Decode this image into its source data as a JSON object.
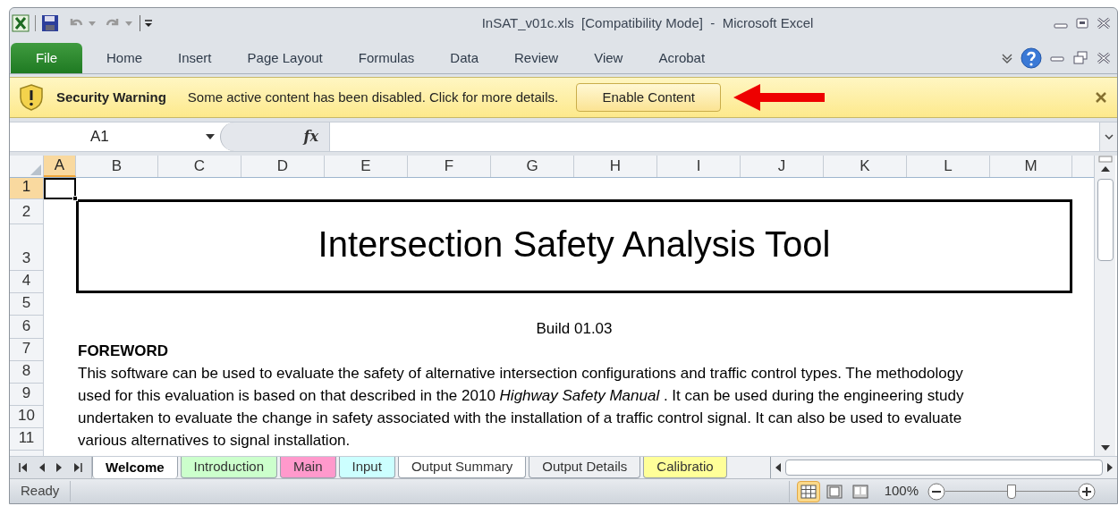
{
  "window": {
    "title": "InSAT_v01c.xls  [Compatibility Mode]  -  Microsoft Excel"
  },
  "file_tab": "File",
  "ribbon_tabs": [
    "Home",
    "Insert",
    "Page Layout",
    "Formulas",
    "Data",
    "Review",
    "View",
    "Acrobat"
  ],
  "security_bar": {
    "title": "Security Warning",
    "message": "Some active content has been disabled. Click for more details.",
    "button": "Enable Content"
  },
  "formula_bar": {
    "name_box": "A1",
    "function_label": "fx"
  },
  "columns": [
    {
      "label": "A",
      "selected": true
    },
    {
      "label": "B",
      "selected": false
    },
    {
      "label": "C",
      "selected": false
    },
    {
      "label": "D",
      "selected": false
    },
    {
      "label": "E",
      "selected": false
    },
    {
      "label": "F",
      "selected": false
    },
    {
      "label": "G",
      "selected": false
    },
    {
      "label": "H",
      "selected": false
    },
    {
      "label": "I",
      "selected": false
    },
    {
      "label": "J",
      "selected": false
    },
    {
      "label": "K",
      "selected": false
    },
    {
      "label": "L",
      "selected": false
    },
    {
      "label": "M",
      "selected": false
    }
  ],
  "title_box": {
    "text": "Intersection Safety Analysis Tool"
  },
  "rows": [
    {
      "label": "1",
      "selected": true
    },
    {
      "label": "2",
      "selected": false
    },
    {
      "label": "3",
      "selected": false
    },
    {
      "label": "4",
      "selected": false
    },
    {
      "label": "5",
      "selected": false
    },
    {
      "label": "6",
      "selected": false,
      "cell": {
        "kind": "center",
        "text": "Build 01.03"
      }
    },
    {
      "label": "7",
      "selected": false,
      "cell": {
        "kind": "heading",
        "text": "FOREWORD"
      }
    },
    {
      "label": "8",
      "selected": false,
      "cell": {
        "kind": "text",
        "text": "This software can be used to evaluate the safety of alternative intersection configurations and traffic control types. The methodology"
      }
    },
    {
      "label": "9",
      "selected": false,
      "cell": {
        "kind": "text",
        "text": "used for this evaluation is based on that described in the 2010 *Highway Safety Manual* . It can be used during the engineering study"
      }
    },
    {
      "label": "10",
      "selected": false,
      "cell": {
        "kind": "text",
        "text": "undertaken to evaluate the change in safety associated with the installation of a traffic control signal. It can also be used to evaluate"
      }
    },
    {
      "label": "11",
      "selected": false,
      "cell": {
        "kind": "text",
        "text": "various alternatives to signal installation."
      }
    }
  ],
  "sheet_tabs": [
    {
      "label": "Welcome",
      "selected": true,
      "color": "#ffffff"
    },
    {
      "label": "Introduction",
      "selected": false,
      "color": "#ccffcc"
    },
    {
      "label": "Main",
      "selected": false,
      "color": "#ff99cc"
    },
    {
      "label": "Input",
      "selected": false,
      "color": "#ccffff"
    },
    {
      "label": "Output Summary",
      "selected": false,
      "color": "#ffffff"
    },
    {
      "label": "Output Details",
      "selected": false,
      "color": "#eef0f3"
    },
    {
      "label": "Calibratio",
      "selected": false,
      "color": "#ffff99"
    }
  ],
  "status_bar": {
    "status": "Ready",
    "views": [
      {
        "kind": "normal",
        "selected": true
      },
      {
        "kind": "page_layout",
        "selected": false
      },
      {
        "kind": "page_break",
        "selected": false
      }
    ],
    "zoom": "100%",
    "zoom_slider": {
      "level": 0.5
    }
  }
}
